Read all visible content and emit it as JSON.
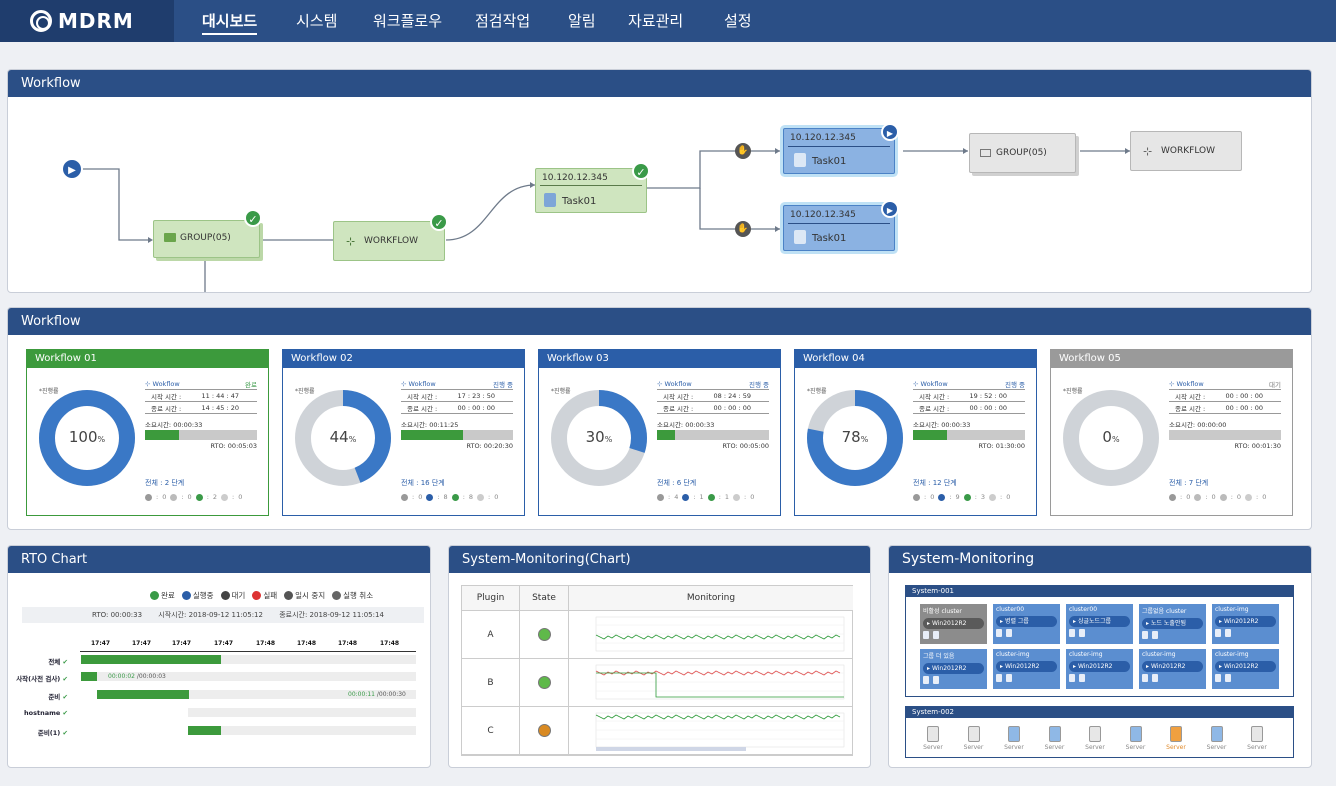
{
  "app": {
    "logo": "MDRM"
  },
  "nav": [
    "대시보드",
    "시스템",
    "워크플로우",
    "점검작업",
    "알림",
    "자료관리",
    "설정"
  ],
  "panels": {
    "workflow_diagram": "Workflow",
    "workflow_cards": "Workflow",
    "rto": "RTO Chart",
    "sys_chart": "System-Monitoring(Chart)",
    "sys_mon": "System-Monitoring"
  },
  "diagram": {
    "group1": "GROUP(05)",
    "workflow1": "WORKFLOW",
    "task_ip": "10.120.12.345",
    "task1": "Task01",
    "task_blue1_ip": "10.120.12.345",
    "task_blue1": "Task01",
    "task_blue2_ip": "10.120.12.345",
    "task_blue2": "Task01",
    "group2": "GROUP(05)",
    "workflow2": "WORKFLOW"
  },
  "card_labels": {
    "progress": "*진행률",
    "wf_link": "Wokflow",
    "start": "시작 시간 :",
    "end": "종료 시간 :",
    "elapsed": "소요시간:",
    "rto": "RTO:"
  },
  "cards": [
    {
      "title": "Workflow 01",
      "color": "#3c9a3c",
      "pct": "100",
      "pct_value": 1.0,
      "status": "완료",
      "start": "11 : 44 : 47",
      "end": "14 : 45 : 20",
      "elapsed": "00:00:33",
      "rto": "00:05:03",
      "bar": 0.3,
      "total": "전체 : 2 단계",
      "counts": [
        "0",
        "0",
        "2",
        "0"
      ]
    },
    {
      "title": "Workflow 02",
      "color": "#2b5ea8",
      "pct": "44",
      "pct_value": 0.44,
      "status": "진행 중",
      "start": "17 : 23 : 50",
      "end": "00 : 00 : 00",
      "elapsed": "00:11:25",
      "rto": "00:20:30",
      "bar": 0.55,
      "total": "전체 : 16 단계",
      "counts": [
        "0",
        "8",
        "8",
        "0"
      ]
    },
    {
      "title": "Workflow 03",
      "color": "#2b5ea8",
      "pct": "30",
      "pct_value": 0.3,
      "status": "진행 중",
      "start": "08 : 24 : 59",
      "end": "00 : 00 : 00",
      "elapsed": "00:00:33",
      "rto": "00:05:00",
      "bar": 0.16,
      "total": "전체 : 6 단계",
      "counts": [
        "4",
        "1",
        "1",
        "0"
      ]
    },
    {
      "title": "Workflow 04",
      "color": "#2b5ea8",
      "pct": "78",
      "pct_value": 0.78,
      "status": "진행 중",
      "start": "19 : 52 : 00",
      "end": "00 : 00 : 00",
      "elapsed": "00:00:33",
      "rto": "01:30:00",
      "bar": 0.3,
      "total": "전체 : 12 단계",
      "counts": [
        "0",
        "9",
        "3",
        "0"
      ]
    },
    {
      "title": "Workflow 05",
      "color": "#9a9a9a",
      "pct": "0",
      "pct_value": 0.0,
      "status": "대기",
      "start": "00 : 00 : 00",
      "end": "00 : 00 : 00",
      "elapsed": "00:00:00",
      "rto": "00:01:30",
      "bar": 0.0,
      "total": "전체 : 7 단계",
      "counts": [
        "0",
        "0",
        "0",
        "0"
      ]
    }
  ],
  "rto": {
    "legend": [
      "완료",
      "실행중",
      "대기",
      "실패",
      "일시 중지",
      "실행 취소"
    ],
    "info": [
      "RTO: 00:00:33",
      "시작시간: 2018-09-12 11:05:12",
      "종료시간: 2018-09-12 11:05:14"
    ],
    "ticks": [
      "17:47",
      "17:47",
      "17:47",
      "17:47",
      "17:48",
      "17:48",
      "17:48",
      "17:48"
    ],
    "rows": [
      {
        "label": "전체",
        "bar_text": "",
        "bar_text2": ""
      },
      {
        "label": "사작(사전 검사)",
        "bar_text": "00:00:02",
        "bar_text2": "/00:00:03"
      },
      {
        "label": "준비",
        "bar_text": "00:00:11",
        "bar_text2": "/00:00:30"
      },
      {
        "label": "hostname",
        "bar_text": "",
        "bar_text2": ""
      },
      {
        "label": "준비(1)",
        "bar_text": "",
        "bar_text2": ""
      }
    ]
  },
  "sys_chart": {
    "headers": [
      "Plugin",
      "State",
      "Monitoring"
    ],
    "rows": [
      {
        "plugin": "A",
        "state_color": "#5fb94a"
      },
      {
        "plugin": "B",
        "state_color": "#5fb94a"
      },
      {
        "plugin": "C",
        "state_color": "#d98a22"
      }
    ]
  },
  "sys_mon": {
    "group1": "System-001",
    "group2": "System-002",
    "clusters": [
      {
        "title": "비활성 cluster",
        "chip": "Win2012R2",
        "dark": true
      },
      {
        "title": "cluster00",
        "chip": "병렬 그룹",
        "dark": false
      },
      {
        "title": "cluster00",
        "chip": "싱글노드그룹",
        "dark": false
      },
      {
        "title": "그룹없음 cluster",
        "chip": "노드 노출안됨",
        "dark": false
      },
      {
        "title": "cluster-img",
        "chip": "Win2012R2",
        "dark": false
      },
      {
        "title": "그룹 더 있음",
        "chip": "Win2012R2",
        "dark": false
      },
      {
        "title": "cluster-img",
        "chip": "Win2012R2",
        "dark": false
      },
      {
        "title": "cluster-img",
        "chip": "Win2012R2",
        "dark": false
      },
      {
        "title": "cluster-img",
        "chip": "Win2012R2",
        "dark": false
      },
      {
        "title": "cluster-img",
        "chip": "Win2012R2",
        "dark": false
      }
    ],
    "servers": [
      "Server",
      "Server",
      "Server",
      "Server",
      "Server",
      "Server",
      "Server",
      "Server",
      "Server"
    ]
  }
}
